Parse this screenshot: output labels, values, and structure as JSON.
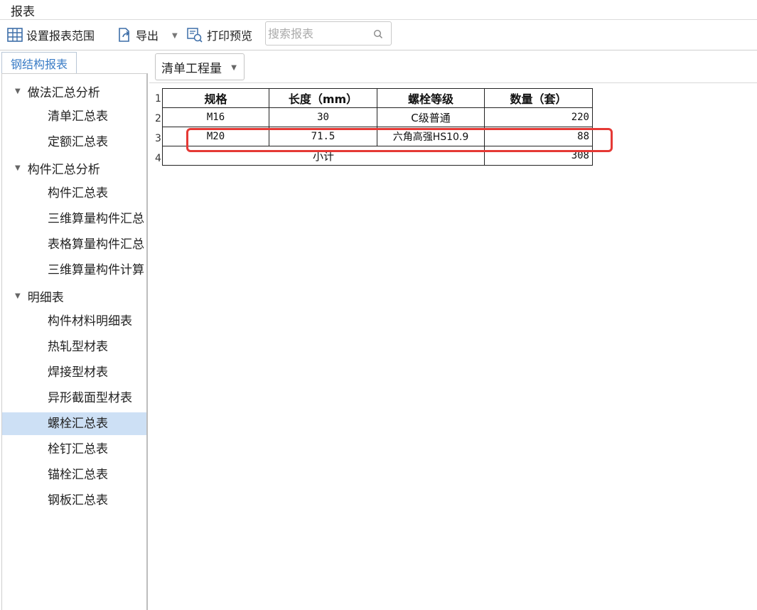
{
  "window": {
    "title": "报表"
  },
  "toolbar": {
    "set_range_label": "设置报表范围",
    "export_label": "导出",
    "print_preview_label": "打印预览",
    "search_placeholder": "搜索报表"
  },
  "left_panel": {
    "tab_label": "钢结构报表",
    "groups": [
      {
        "label": "做法汇总分析",
        "items": [
          "清单汇总表",
          "定额汇总表"
        ]
      },
      {
        "label": "构件汇总分析",
        "items": [
          "构件汇总表",
          "三维算量构件汇总",
          "表格算量构件汇总",
          "三维算量构件计算"
        ]
      },
      {
        "label": "明细表",
        "items": [
          "构件材料明细表",
          "热轧型材表",
          "焊接型材表",
          "异形截面型材表",
          "螺栓汇总表",
          "栓钉汇总表",
          "锚栓汇总表",
          "钢板汇总表"
        ]
      }
    ],
    "selected_item": "螺栓汇总表"
  },
  "main": {
    "dropdown_value": "清单工程量",
    "row_numbers": [
      "1",
      "2",
      "3",
      "4"
    ],
    "table": {
      "headers": [
        "规格",
        "长度（mm）",
        "螺栓等级",
        "数量（套）"
      ],
      "rows": [
        [
          "M16",
          "30",
          "C级普通",
          "220"
        ],
        [
          "M20",
          "71.5",
          "六角高强HS10.9",
          "88"
        ]
      ],
      "subtotal_label": "小计",
      "subtotal_value": "308"
    }
  },
  "colors": {
    "highlight": "#e53935",
    "selected_bg": "#cde0f5",
    "tab_text": "#3a7cc6"
  }
}
